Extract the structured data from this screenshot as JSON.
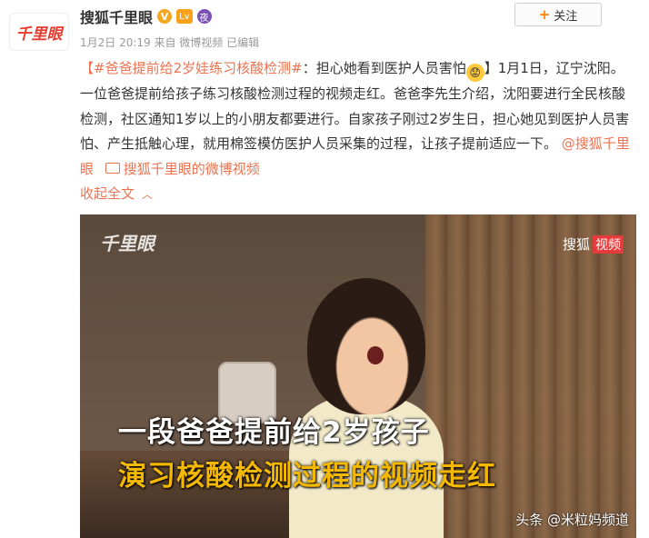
{
  "header": {
    "logo_text": "千里眼",
    "name": "搜狐千里眼",
    "badges": {
      "verified": "V",
      "level": "Lv",
      "night": "夜"
    },
    "meta": "1月2日 20:19 来自 微博视频  已编辑",
    "follow_label": "关注"
  },
  "post": {
    "hashtag": "【#爸爸提前给2岁娃练习核酸检测#",
    "text_1": "：担心她看到医护人员害怕",
    "text_2": "】1月1日，辽宁沈阳。一位爸爸提前给孩子练习核酸检测过程的视频走红。爸爸李先生介绍，沈阳要进行全民核酸检测，社区通知1岁以上的小朋友都要进行。自家孩子刚过2岁生日，担心她见到医护人员害怕、产生抵触心理，就用棉签模仿医护人员采集的过程，让孩子提前适应一下。",
    "mention": "@搜狐千里眼",
    "video_link": "搜狐千里眼的微博视频",
    "collapse_label": "收起全文"
  },
  "video": {
    "watermark_left": "千里眼",
    "watermark_right_a": "搜狐",
    "watermark_right_b": "视频",
    "caption_1": "一段爸爸提前给2岁孩子",
    "caption_2": "演习核酸检测过程的视频走红",
    "source": "头条 @米粒妈频道"
  },
  "colors": {
    "accent": "#eb7350",
    "caption_yellow": "#f5b800",
    "follow_plus": "#ff8200"
  }
}
